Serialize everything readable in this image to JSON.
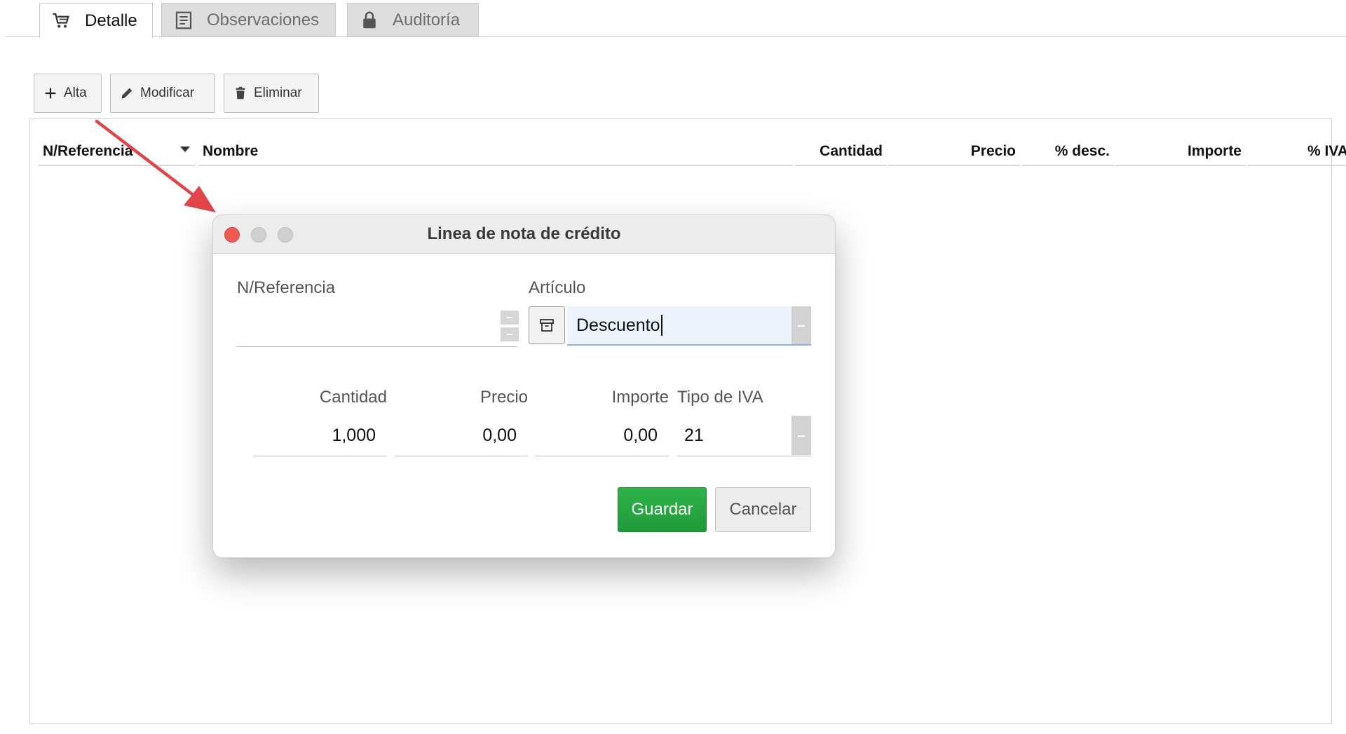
{
  "tabs": [
    {
      "label": "Detalle",
      "icon": "cart-icon",
      "active": true
    },
    {
      "label": "Observaciones",
      "icon": "notes-icon",
      "active": false
    },
    {
      "label": "Auditoría",
      "icon": "lock-icon",
      "active": false
    }
  ],
  "toolbar": {
    "add_label": "Alta",
    "edit_label": "Modificar",
    "delete_label": "Eliminar"
  },
  "grid": {
    "columns": [
      "N/Referencia",
      "Nombre",
      "Cantidad",
      "Precio",
      "% desc.",
      "Importe",
      "% IVA"
    ]
  },
  "dialog": {
    "title": "Linea de nota de crédito",
    "ref_label": "N/Referencia",
    "ref_value": "",
    "article_label": "Artículo",
    "article_value": "Descuento",
    "qty_label": "Cantidad",
    "qty_value": "1,000",
    "price_label": "Precio",
    "price_value": "0,00",
    "amount_label": "Importe",
    "amount_value": "0,00",
    "vat_label": "Tipo de IVA",
    "vat_value": "21",
    "save_label": "Guardar",
    "cancel_label": "Cancelar"
  },
  "colors": {
    "save_button": "#24a440",
    "close_light": "#ee5b52",
    "annotation_arrow": "#e0454a"
  }
}
